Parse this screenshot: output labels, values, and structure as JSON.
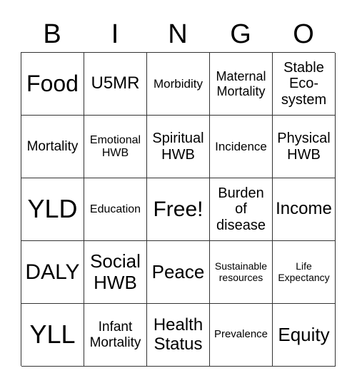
{
  "header": [
    "B",
    "I",
    "N",
    "G",
    "O"
  ],
  "cells": [
    "Food",
    "U5MR",
    "Morbidity",
    "Maternal Mortality",
    "Stable Eco-system",
    "Mortality",
    "Emotional HWB",
    "Spiritual HWB",
    "Incidence",
    "Physical HWB",
    "YLD",
    "Education",
    "Free!",
    "Burden of disease",
    "Income",
    "DALY",
    "Social HWB",
    "Peace",
    "Sustainable resources",
    "Life Expectancy",
    "YLL",
    "Infant Mortality",
    "Health Status",
    "Prevalence",
    "Equity"
  ]
}
